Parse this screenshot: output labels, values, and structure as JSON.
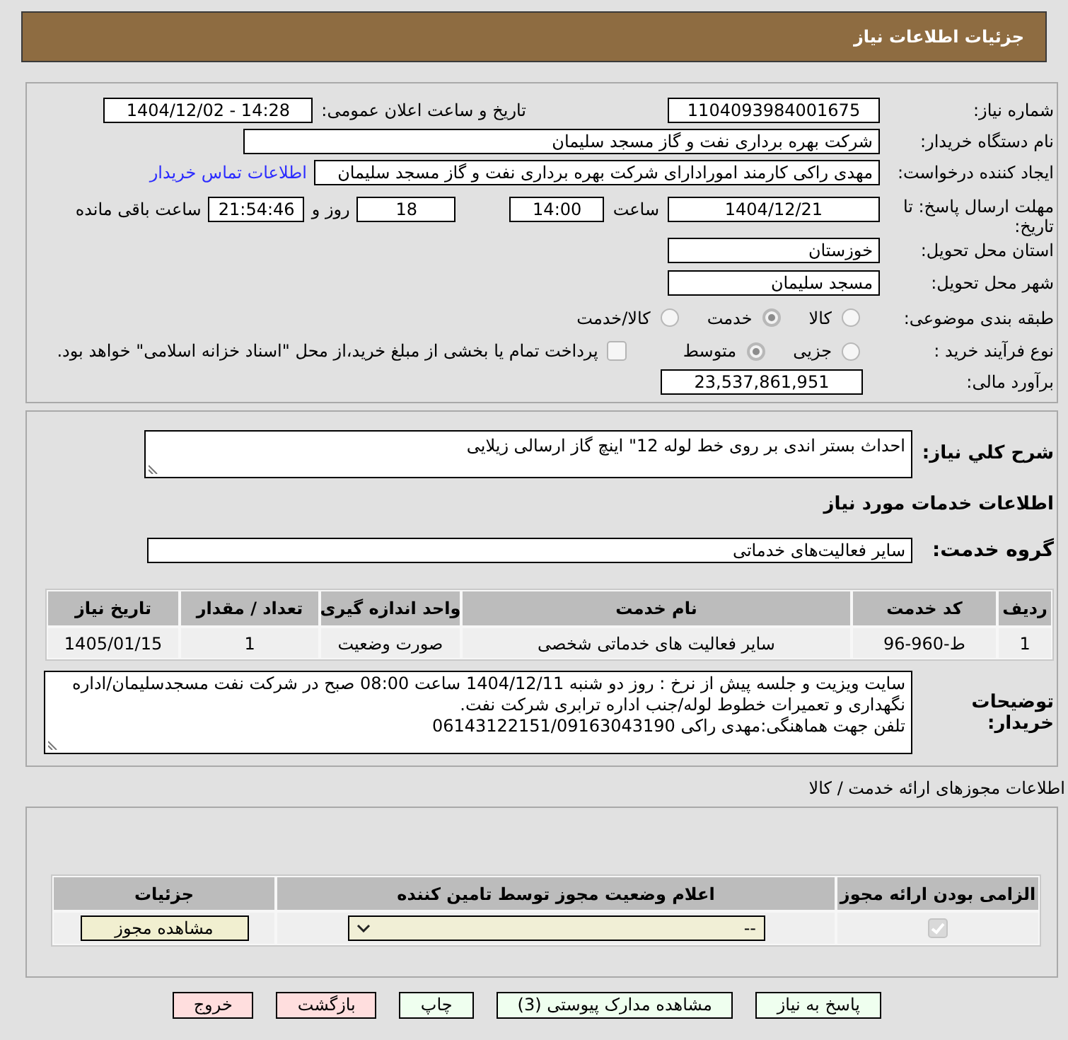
{
  "header": {
    "title": "جزئیات اطلاعات نیاز"
  },
  "details": {
    "need_number": {
      "label": "شماره نیاز:",
      "value": "1104093984001675"
    },
    "announce": {
      "label": "تاریخ و ساعت اعلان عمومی:",
      "value": "1404/12/02 - 14:28"
    },
    "buyer_org": {
      "label": "نام دستگاه خریدار:",
      "value": "شرکت بهره برداری نفت و گاز مسجد سلیمان"
    },
    "requester": {
      "label": "ایجاد کننده درخواست:",
      "value": "مهدی راکی کارمند امورادارای شرکت بهره برداری نفت و گاز مسجد سلیمان",
      "link": "اطلاعات تماس خریدار"
    },
    "deadline": {
      "label": "مهلت ارسال پاسخ: تا تاریخ:",
      "date": "1404/12/21",
      "time_label": "ساعت",
      "time": "14:00",
      "days": "18",
      "days_label": "روز و",
      "remaining": "21:54:46",
      "remaining_label": "ساعت باقی مانده"
    },
    "province": {
      "label": "استان محل تحویل:",
      "value": "خوزستان"
    },
    "city": {
      "label": "شهر محل تحویل:",
      "value": "مسجد سلیمان"
    },
    "category": {
      "label": "طبقه بندی موضوعی:",
      "options": [
        {
          "label": "کالا",
          "selected": false
        },
        {
          "label": "خدمت",
          "selected": true
        },
        {
          "label": "کالا/خدمت",
          "selected": false
        }
      ]
    },
    "process": {
      "label": "نوع فرآیند خرید :",
      "options": [
        {
          "label": "جزیی",
          "selected": false
        },
        {
          "label": "متوسط",
          "selected": true
        }
      ],
      "treasury": {
        "label": "پرداخت تمام یا بخشی از مبلغ خرید،از محل \"اسناد خزانه اسلامی\" خواهد بود.",
        "checked": false
      }
    },
    "budget": {
      "label": "برآورد مالی:",
      "value": "23,537,861,951"
    }
  },
  "need": {
    "summary_label": "شرح کلي نیاز:",
    "summary": "احداث بستر اندی بر روی خط لوله 12\" اینچ گاز ارسالی زیلایی",
    "services_title": "اطلاعات خدمات مورد نیاز",
    "group_label": "گروه خدمت:",
    "group": "سایر فعالیت‌های خدماتی",
    "table": {
      "columns": [
        "ردیف",
        "کد خدمت",
        "نام خدمت",
        "واحد اندازه گیری",
        "تعداد / مقدار",
        "تاریخ نیاز"
      ],
      "rows": [
        [
          "1",
          "ط-960-96",
          "سایر فعالیت های خدماتی شخصی",
          "صورت وضعیت",
          "1",
          "1405/01/15"
        ]
      ]
    },
    "notes_label": "توضیحات خریدار:",
    "notes": [
      "سایت ویزیت و جلسه پیش از نرخ  : روز دو شنبه 1404/12/11 ساعت 08:00 صبح  در شرکت نفت مسجدسلیمان/اداره نگهداری و تعمیرات خطوط لوله/جنب اداره ترابری شرکت نفت.",
      "تلفن جهت هماهنگی:مهدی راکی 06143122151/09163043190"
    ]
  },
  "licenses": {
    "title": "اطلاعات مجوزهای ارائه خدمت / کالا",
    "columns": [
      "الزامی بودن ارائه مجوز",
      "اعلام وضعیت مجوز توسط تامین کننده",
      "جزئیات"
    ],
    "rows": [
      {
        "required": {
          "checked": true
        },
        "status": "--",
        "details_button": "مشاهده مجوز"
      }
    ]
  },
  "buttons": [
    {
      "label": "پاسخ به نیاز",
      "kind": "action"
    },
    {
      "label": "مشاهده مدارک پیوستی (3)",
      "kind": "action"
    },
    {
      "label": "چاپ",
      "kind": "action"
    },
    {
      "label": "بازگشت",
      "kind": "leave"
    },
    {
      "label": "خروج",
      "kind": "leave"
    }
  ]
}
